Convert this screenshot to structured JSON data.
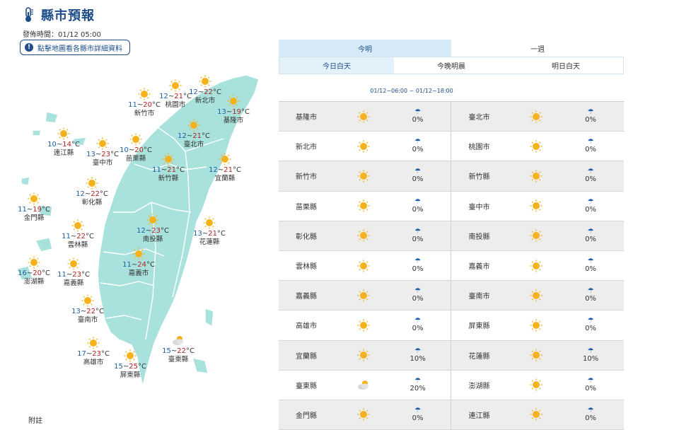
{
  "header": {
    "title": "縣市預報",
    "issue_time": "發佈時間：01/12 05:00",
    "map_hint": "點擊地圖看各縣市詳細資料",
    "footnote": "附註"
  },
  "colors": {
    "accent": "#1d4e89",
    "tab_active": "#d6eaf8",
    "map_land": "#a9e2dc",
    "low_temp": "#1c5fa8",
    "high_temp": "#b52121"
  },
  "map": {
    "cities": [
      {
        "name": "桃園市",
        "low": "12",
        "high": "21",
        "icon": "sunny"
      },
      {
        "name": "新北市",
        "low": "12",
        "high": "22",
        "icon": "sunny"
      },
      {
        "name": "基隆市",
        "low": "13",
        "high": "19",
        "icon": "sunny"
      },
      {
        "name": "新竹市",
        "low": "11",
        "high": "20",
        "icon": "sunny"
      },
      {
        "name": "臺北市",
        "low": "12",
        "high": "21",
        "icon": "sunny"
      },
      {
        "name": "連江縣",
        "low": "10",
        "high": "14",
        "icon": "sunny"
      },
      {
        "name": "臺中市",
        "low": "13",
        "high": "23",
        "icon": "sunny"
      },
      {
        "name": "苗栗縣",
        "low": "10",
        "high": "20",
        "icon": "sunny"
      },
      {
        "name": "新竹縣",
        "low": "11",
        "high": "21",
        "icon": "sunny"
      },
      {
        "name": "宜蘭縣",
        "low": "12",
        "high": "21",
        "icon": "sunny"
      },
      {
        "name": "彰化縣",
        "low": "12",
        "high": "22",
        "icon": "sunny"
      },
      {
        "name": "金門縣",
        "low": "11",
        "high": "19",
        "icon": "sunny"
      },
      {
        "name": "南投縣",
        "low": "12",
        "high": "23",
        "icon": "sunny"
      },
      {
        "name": "花蓮縣",
        "low": "13",
        "high": "21",
        "icon": "sunny"
      },
      {
        "name": "雲林縣",
        "low": "11",
        "high": "22",
        "icon": "sunny"
      },
      {
        "name": "嘉義市",
        "low": "11",
        "high": "24",
        "icon": "sunny"
      },
      {
        "name": "澎湖縣",
        "low": "16",
        "high": "20",
        "icon": "sunny"
      },
      {
        "name": "嘉義縣",
        "low": "11",
        "high": "23",
        "icon": "sunny"
      },
      {
        "name": "臺南市",
        "low": "13",
        "high": "22",
        "icon": "sunny"
      },
      {
        "name": "臺東縣",
        "low": "15",
        "high": "22",
        "icon": "partly-cloudy"
      },
      {
        "name": "高雄市",
        "low": "17",
        "high": "23",
        "icon": "sunny"
      },
      {
        "name": "屏東縣",
        "low": "15",
        "high": "25",
        "icon": "sunny"
      }
    ]
  },
  "tabs": [
    "今明",
    "一週"
  ],
  "subtabs": [
    "今日白天",
    "今晚明晨",
    "明日白天"
  ],
  "period": "01/12−06:00 ~ 01/12−18:00",
  "table": {
    "rows": [
      [
        {
          "name": "基隆市",
          "icon": "sunny",
          "pop": "0%"
        },
        {
          "name": "臺北市",
          "icon": "sunny",
          "pop": "0%"
        }
      ],
      [
        {
          "name": "新北市",
          "icon": "sunny",
          "pop": "0%"
        },
        {
          "name": "桃園市",
          "icon": "sunny",
          "pop": "0%"
        }
      ],
      [
        {
          "name": "新竹市",
          "icon": "sunny",
          "pop": "0%"
        },
        {
          "name": "新竹縣",
          "icon": "sunny",
          "pop": "0%"
        }
      ],
      [
        {
          "name": "苗栗縣",
          "icon": "sunny",
          "pop": "0%"
        },
        {
          "name": "臺中市",
          "icon": "sunny",
          "pop": "0%"
        }
      ],
      [
        {
          "name": "彰化縣",
          "icon": "sunny",
          "pop": "0%"
        },
        {
          "name": "南投縣",
          "icon": "sunny",
          "pop": "0%"
        }
      ],
      [
        {
          "name": "雲林縣",
          "icon": "sunny",
          "pop": "0%"
        },
        {
          "name": "嘉義市",
          "icon": "sunny",
          "pop": "0%"
        }
      ],
      [
        {
          "name": "嘉義縣",
          "icon": "sunny",
          "pop": "0%"
        },
        {
          "name": "臺南市",
          "icon": "sunny",
          "pop": "0%"
        }
      ],
      [
        {
          "name": "高雄市",
          "icon": "sunny",
          "pop": "0%"
        },
        {
          "name": "屏東縣",
          "icon": "sunny",
          "pop": "0%"
        }
      ],
      [
        {
          "name": "宜蘭縣",
          "icon": "sunny",
          "pop": "10%"
        },
        {
          "name": "花蓮縣",
          "icon": "sunny",
          "pop": "10%"
        }
      ],
      [
        {
          "name": "臺東縣",
          "icon": "partly-cloudy",
          "pop": "20%"
        },
        {
          "name": "澎湖縣",
          "icon": "sunny",
          "pop": "0%"
        }
      ],
      [
        {
          "name": "金門縣",
          "icon": "sunny",
          "pop": "0%"
        },
        {
          "name": "連江縣",
          "icon": "sunny",
          "pop": "0%"
        }
      ]
    ]
  }
}
